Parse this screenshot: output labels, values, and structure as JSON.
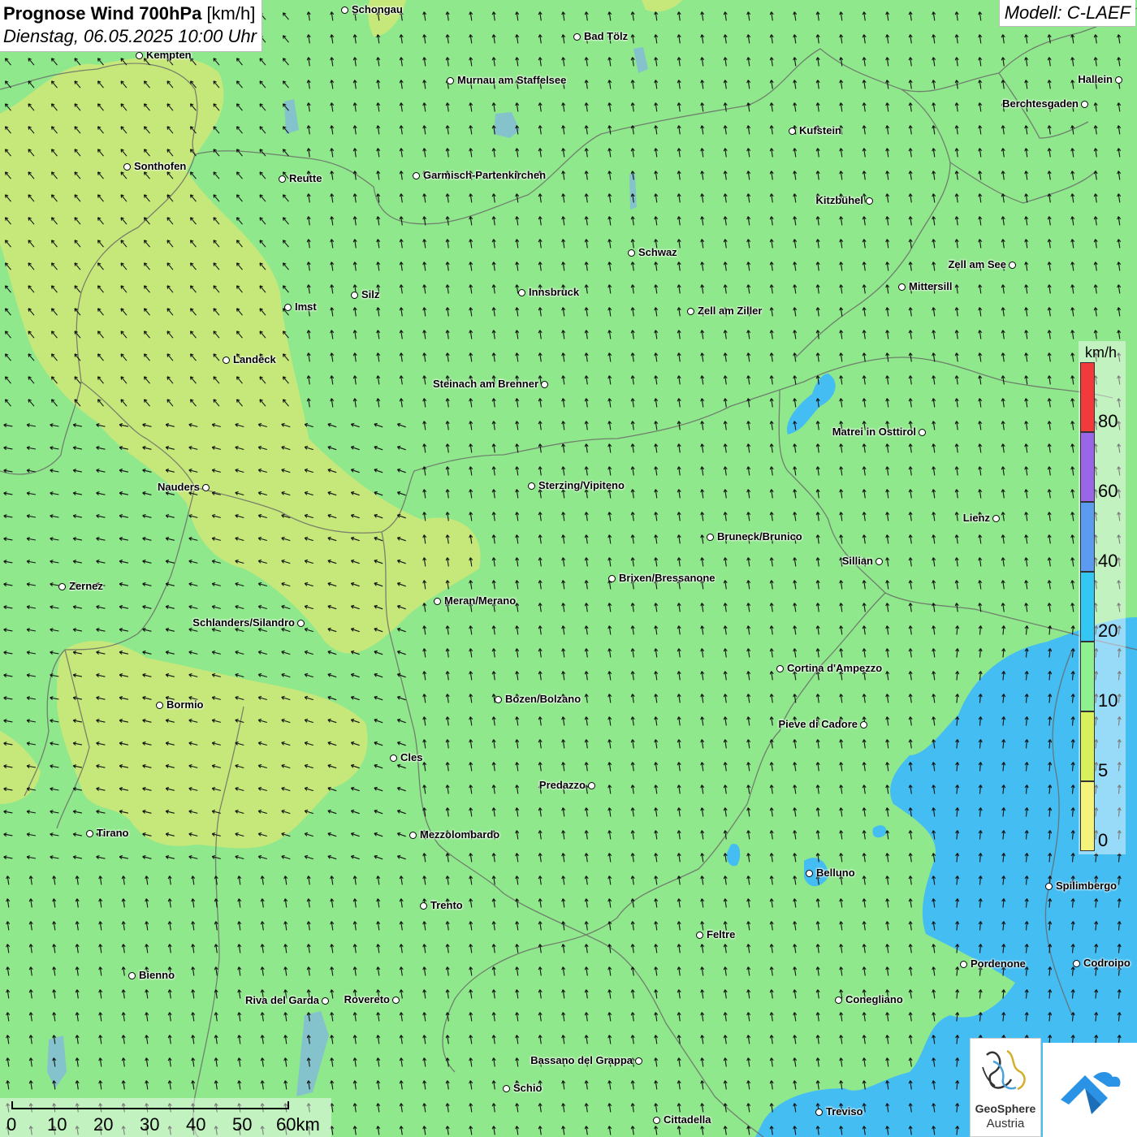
{
  "title": {
    "main": "Prognose Wind 700hPa",
    "unit": "[km/h]",
    "date": "Dienstag, 06.05.2025 10:00 Uhr"
  },
  "model": "Modell: C-LAEF",
  "legend": {
    "unit": "km/h",
    "ticks": [
      "80",
      "60",
      "40",
      "20",
      "10",
      "5",
      "0"
    ],
    "colors": [
      "#f23a3a",
      "#9a66e8",
      "#5c9cf0",
      "#33c8f4",
      "#8ef08e",
      "#d8f05a",
      "#f4f47a"
    ]
  },
  "scale": {
    "labels": [
      "0",
      "10",
      "20",
      "30",
      "40",
      "50",
      "60km"
    ]
  },
  "logo": {
    "line1": "GeoSphere",
    "line2": "Austria"
  },
  "colors": {
    "background": "#90e88c",
    "calm_zone": "#cce878",
    "strong_zone": "#44bdf2"
  },
  "cities": [
    {
      "name": "Schongau"
    },
    {
      "name": "Bad Tölz"
    },
    {
      "name": "Kempten"
    },
    {
      "name": "Murnau am Staffelsee"
    },
    {
      "name": "Hallein"
    },
    {
      "name": "Berchtesgaden"
    },
    {
      "name": "Kufstein"
    },
    {
      "name": "Sonthofen"
    },
    {
      "name": "Reutte"
    },
    {
      "name": "Garmisch-Partenkirchen"
    },
    {
      "name": "Kitzbühel"
    },
    {
      "name": "Schwaz"
    },
    {
      "name": "Zell am See"
    },
    {
      "name": "Mittersill"
    },
    {
      "name": "Innsbruck"
    },
    {
      "name": "Silz"
    },
    {
      "name": "Imst"
    },
    {
      "name": "Zell am Ziller"
    },
    {
      "name": "Landeck"
    },
    {
      "name": "Steinach am Brenner"
    },
    {
      "name": "Matrei in Osttirol"
    },
    {
      "name": "Nauders"
    },
    {
      "name": "Sterzing/Vipiteno"
    },
    {
      "name": "Lienz"
    },
    {
      "name": "Bruneck/Brunico"
    },
    {
      "name": "Sillian"
    },
    {
      "name": "Brixen/Bressanone"
    },
    {
      "name": "Zernez"
    },
    {
      "name": "Meran/Merano"
    },
    {
      "name": "Schlanders/Silandro"
    },
    {
      "name": "Cortina d'Ampezzo"
    },
    {
      "name": "Bozen/Bolzano"
    },
    {
      "name": "Bormio"
    },
    {
      "name": "Pieve di Cadore"
    },
    {
      "name": "Cles"
    },
    {
      "name": "Predazzo"
    },
    {
      "name": "Tirano"
    },
    {
      "name": "Mezzolombardo"
    },
    {
      "name": "Belluno"
    },
    {
      "name": "Spilimbergo"
    },
    {
      "name": "Trento"
    },
    {
      "name": "Feltre"
    },
    {
      "name": "Pordenone"
    },
    {
      "name": "Codroipo"
    },
    {
      "name": "Bienno"
    },
    {
      "name": "Riva del Garda"
    },
    {
      "name": "Rovereto"
    },
    {
      "name": "Conegliano"
    },
    {
      "name": "Bassano del Grappa"
    },
    {
      "name": "Schio"
    },
    {
      "name": "Treviso"
    },
    {
      "name": "Cittadella"
    }
  ]
}
